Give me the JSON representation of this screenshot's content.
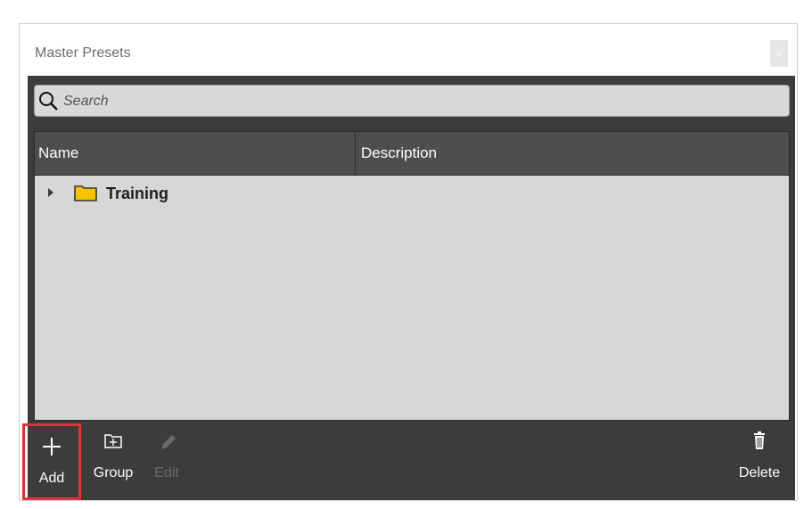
{
  "window": {
    "title": "Master Presets",
    "close_label": "x"
  },
  "search": {
    "placeholder": "Search"
  },
  "table": {
    "columns": [
      "Name",
      "Description"
    ],
    "rows": [
      {
        "name": "Training",
        "description": "",
        "type": "folder",
        "expanded": false
      }
    ]
  },
  "toolbar": {
    "add_label": "Add",
    "group_label": "Group",
    "edit_label": "Edit",
    "delete_label": "Delete"
  },
  "colors": {
    "panel": "#3c3c3c",
    "list_bg": "#d7d7d7",
    "header_bg": "#4e4e4e",
    "highlight": "#e0323a",
    "folder": "#f6c400"
  },
  "icons": {
    "search": "search-icon",
    "folder": "folder-icon",
    "add": "plus-icon",
    "group": "folder-plus-icon",
    "edit": "pencil-icon",
    "delete": "trash-icon"
  }
}
